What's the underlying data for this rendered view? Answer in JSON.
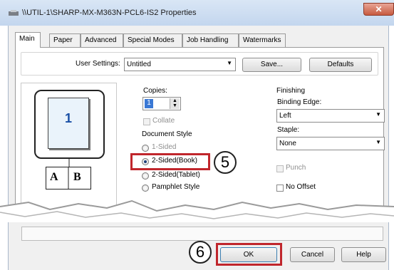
{
  "window": {
    "title": "\\\\UTIL-1\\SHARP-MX-M363N-PCL6-IS2 Properties",
    "close_glyph": "✕"
  },
  "tabs": [
    {
      "label": "Main",
      "active": true
    },
    {
      "label": "Paper"
    },
    {
      "label": "Advanced"
    },
    {
      "label": "Special Modes"
    },
    {
      "label": "Job Handling"
    },
    {
      "label": "Watermarks"
    }
  ],
  "user_settings": {
    "label": "User Settings:",
    "value": "Untitled",
    "save_label": "Save...",
    "defaults_label": "Defaults"
  },
  "preview": {
    "page_number": "1",
    "book_left": "A",
    "book_right": "B"
  },
  "copies": {
    "label": "Copies:",
    "value": "1",
    "collate_label": "Collate"
  },
  "document_style": {
    "label": "Document Style",
    "options": [
      "1-Sided",
      "2-Sided(Book)",
      "2-Sided(Tablet)",
      "Pamphlet Style"
    ],
    "selected_index": 1
  },
  "finishing": {
    "label": "Finishing",
    "binding_edge_label": "Binding Edge:",
    "binding_edge_value": "Left",
    "staple_label": "Staple:",
    "staple_value": "None",
    "punch_label": "Punch",
    "no_offset_label": "No Offset"
  },
  "callouts": {
    "step5": "5",
    "step6": "6"
  },
  "buttons": {
    "ok": "OK",
    "cancel": "Cancel",
    "help": "Help"
  },
  "colors": {
    "highlight": "#c0262c",
    "preview_number": "#1a4fa5"
  }
}
